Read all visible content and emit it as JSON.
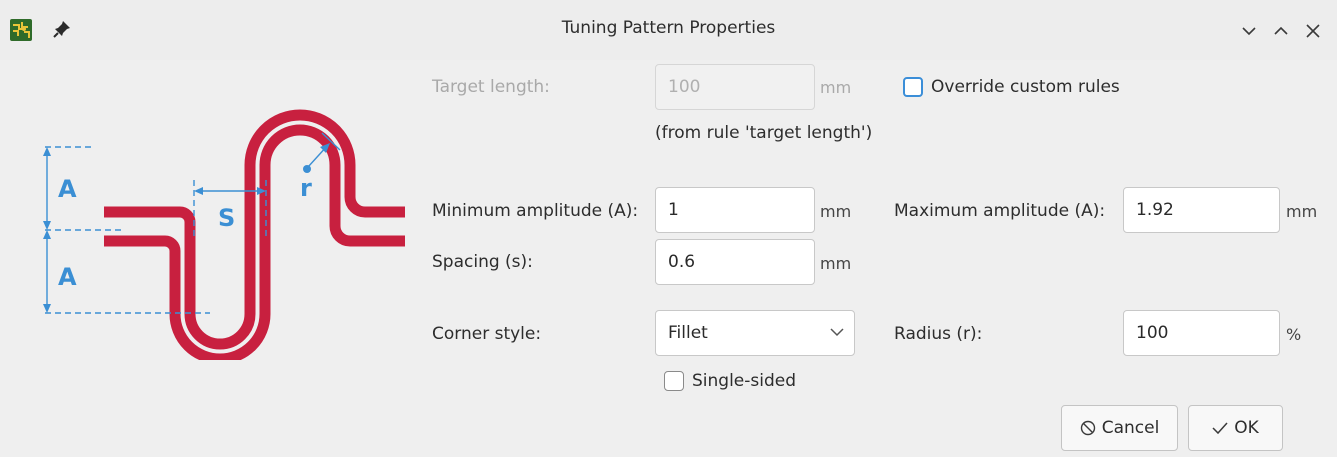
{
  "window": {
    "title": "Tuning Pattern Properties",
    "icons": [
      "kicad-pcb-app-icon",
      "pin-icon",
      "minimize-chevron-icon",
      "maximize-chevron-icon",
      "close-icon"
    ]
  },
  "diagram": {
    "label_a_top": "A",
    "label_a_bottom": "A",
    "label_s": "S",
    "label_r": "r",
    "trace_color": "#c8203f",
    "dimension_color": "#3b8fd4"
  },
  "form": {
    "target_length": {
      "label": "Target length:",
      "value": "100",
      "unit": "mm",
      "enabled": false
    },
    "override_custom_rules": {
      "label": "Override custom rules",
      "checked": false
    },
    "from_rule": "(from rule 'target length')",
    "min_amplitude": {
      "label": "Minimum amplitude (A):",
      "value": "1",
      "unit": "mm"
    },
    "max_amplitude": {
      "label": "Maximum amplitude (A):",
      "value": "1.92",
      "unit": "mm"
    },
    "spacing": {
      "label": "Spacing (s):",
      "value": "0.6",
      "unit": "mm"
    },
    "corner_style": {
      "label": "Corner style:",
      "value": "Fillet"
    },
    "radius": {
      "label": "Radius (r):",
      "value": "100",
      "unit": "%"
    },
    "single_sided": {
      "label": "Single-sided",
      "checked": false
    }
  },
  "buttons": {
    "cancel": "Cancel",
    "ok": "OK"
  }
}
